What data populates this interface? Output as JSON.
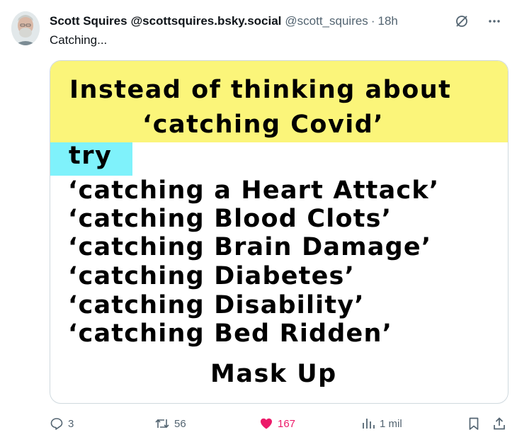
{
  "post": {
    "author_name": "Scott Squires",
    "author_display_handle": "@scottsquires.bsky.social",
    "handle": "@scott_squires",
    "separator": "·",
    "time": "18h",
    "text": "Catching..."
  },
  "image": {
    "heading_line_1": "Instead of thinking about",
    "heading_line_2": "‘catching Covid’",
    "try_label": "try",
    "items": [
      "‘catching a Heart Attack’",
      "‘catching Blood Clots’",
      "‘catching Brain Damage’",
      "‘catching Diabetes’",
      "‘catching Disability’",
      "‘catching Bed Ridden’"
    ],
    "footer": "Mask Up",
    "colors": {
      "top_band": "#fbf57a",
      "try_band": "#7ff2fb"
    }
  },
  "actions": {
    "replies": "3",
    "reposts": "56",
    "likes": "167",
    "views": "1 mil"
  },
  "icons": {
    "header": [
      "grok-icon",
      "more-icon"
    ],
    "actions": [
      "reply-icon",
      "repost-icon",
      "like-icon",
      "views-icon",
      "bookmark-icon",
      "share-icon"
    ]
  },
  "colors": {
    "like_active": "#ec1a69",
    "muted_text": "#536471",
    "text": "#0f1419"
  }
}
